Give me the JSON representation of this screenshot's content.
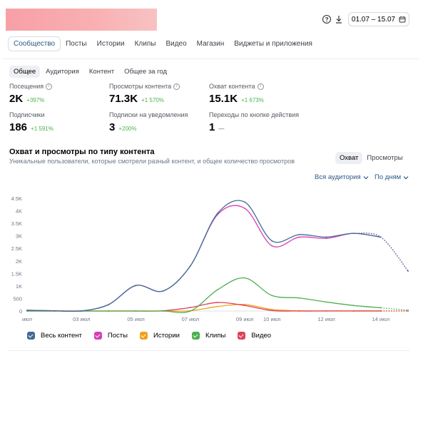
{
  "header": {
    "date_range": "01.07 – 15.07",
    "icons": [
      "help-icon",
      "download-icon",
      "calendar-icon"
    ]
  },
  "top_tabs": [
    "Сообщество",
    "Посты",
    "Истории",
    "Клипы",
    "Видео",
    "Магазин",
    "Виджеты и приложения"
  ],
  "sub_tabs": [
    "Общее",
    "Аудитория",
    "Контент",
    "Общее за год"
  ],
  "metrics": {
    "visits": {
      "label": "Посещения",
      "value": "2K",
      "delta": "+397%"
    },
    "content_views": {
      "label": "Просмотры контента",
      "value": "71.3K",
      "delta": "+1 570%"
    },
    "content_reach": {
      "label": "Охват контента",
      "value": "15.1K",
      "delta": "+1 673%"
    },
    "subscribers": {
      "label": "Подписчики",
      "value": "186",
      "delta": "+1 591%"
    },
    "notif_subs": {
      "label": "Подписки на уведомления",
      "value": "3",
      "delta": "+200%"
    },
    "action_clicks": {
      "label": "Переходы по кнопке действия",
      "value": "1",
      "delta": "—"
    }
  },
  "chart_section": {
    "title": "Охват и просмотры по типу контента",
    "subtitle": "Уникальные пользователи, которые смотрели разный контент, и общее количество просмотров",
    "toggle": [
      "Охват",
      "Просмотры"
    ],
    "audience_dropdown": "Вся аудитория",
    "period_dropdown": "По дням"
  },
  "chart_data": {
    "type": "line",
    "x": [
      "01 июл",
      "02 июл",
      "03 июл",
      "04 июл",
      "05 июл",
      "06 июл",
      "07 июл",
      "08 июл",
      "09 июл",
      "10 июл",
      "11 июл",
      "12 июл",
      "13 июл",
      "14 июл",
      "15 июл"
    ],
    "x_tick_labels": [
      "июл",
      "03 июл",
      "05 июл",
      "07 июл",
      "09 июл",
      "10 июл",
      "12 июл",
      "14 июл"
    ],
    "y_tick_labels": [
      "0",
      "500",
      "1K",
      "1.5K",
      "2K",
      "2.5K",
      "3K",
      "3.5K",
      "4K",
      "4.5K"
    ],
    "ylim": [
      0,
      4500
    ],
    "series": [
      {
        "name": "Весь контент",
        "color": "#3f6b96",
        "values": [
          30,
          10,
          5,
          260,
          1020,
          800,
          1800,
          3900,
          4350,
          2800,
          3050,
          2950,
          3100,
          2950,
          1600
        ]
      },
      {
        "name": "Посты",
        "color": "#d63fb5",
        "values": [
          30,
          10,
          5,
          260,
          1020,
          800,
          1800,
          3850,
          4100,
          2600,
          2950,
          2900,
          3100,
          2950,
          1600
        ]
      },
      {
        "name": "Истории",
        "color": "#f0a01c",
        "values": [
          0,
          0,
          0,
          0,
          0,
          0,
          10,
          180,
          260,
          60,
          10,
          5,
          5,
          5,
          5
        ]
      },
      {
        "name": "Клипы",
        "color": "#4caf50",
        "values": [
          0,
          0,
          0,
          0,
          0,
          0,
          0,
          850,
          1320,
          620,
          520,
          360,
          220,
          130,
          30
        ]
      },
      {
        "name": "Видео",
        "color": "#e0405a",
        "values": [
          0,
          0,
          0,
          0,
          0,
          10,
          140,
          340,
          220,
          20,
          0,
          0,
          0,
          0,
          0
        ]
      }
    ],
    "grid": false,
    "legend": "bottom-left"
  }
}
